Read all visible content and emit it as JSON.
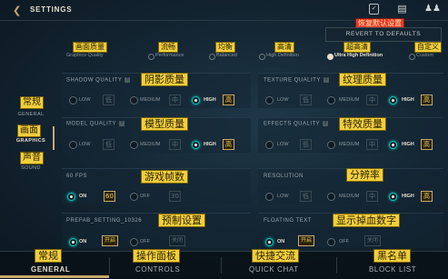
{
  "header": {
    "back_icon": "back-arrow-icon",
    "title": "SETTINGS",
    "icons": [
      "profile-card-icon",
      "chat-icon",
      "friends-icon"
    ]
  },
  "revert": {
    "label": "REVERT TO DEFAULTS",
    "annotation": "恢复默认设置"
  },
  "sidebar": {
    "items": [
      {
        "label": "GENERAL",
        "annotation": "常规"
      },
      {
        "label": "GRAPHICS",
        "annotation": "画面",
        "active": true
      },
      {
        "label": "SOUND",
        "annotation": "声音"
      }
    ]
  },
  "presets": {
    "title_annotation": "画面质量",
    "label": "Graphics Quality",
    "options": [
      {
        "label": "Performance",
        "annotation": "流畅"
      },
      {
        "label": "Balanced",
        "annotation": "均衡"
      },
      {
        "label": "High Definition",
        "annotation": "高清"
      },
      {
        "label": "Ultra High Definition",
        "annotation": "超高清",
        "selected": true
      },
      {
        "label": "Custom",
        "annotation": "自定义"
      }
    ]
  },
  "settings": {
    "shadow": {
      "title": "SHADOW QUALITY",
      "annotation": "阴影质量",
      "options": [
        {
          "label": "LOW",
          "box": "低"
        },
        {
          "label": "MEDIUM",
          "box": "中"
        },
        {
          "label": "HIGH",
          "box": "高",
          "selected": true
        }
      ]
    },
    "texture": {
      "title": "TEXTURE QUALITY",
      "annotation": "纹理质量",
      "options": [
        {
          "label": "LOW",
          "box": "低"
        },
        {
          "label": "MEDIUM",
          "box": "中"
        },
        {
          "label": "HIGH",
          "box": "高",
          "selected": true
        }
      ]
    },
    "model": {
      "title": "MODEL QUALITY",
      "annotation": "模型质量",
      "options": [
        {
          "label": "LOW",
          "box": "低"
        },
        {
          "label": "MEDIUM",
          "box": "中"
        },
        {
          "label": "HIGH",
          "box": "高",
          "selected": true
        }
      ]
    },
    "effects": {
      "title": "EFFECTS QUALITY",
      "annotation": "特效质量",
      "options": [
        {
          "label": "LOW",
          "box": "低"
        },
        {
          "label": "MEDIUM",
          "box": "中"
        },
        {
          "label": "HIGH",
          "box": "高",
          "selected": true
        }
      ]
    },
    "fps": {
      "title": "60 FPS",
      "annotation": "游戏帧数",
      "options": [
        {
          "label": "ON",
          "box": "60",
          "selected": true
        },
        {
          "label": "OFF",
          "box": "30"
        }
      ]
    },
    "resolution": {
      "title": "RESOLUTION",
      "annotation": "分辨率",
      "options": [
        {
          "label": "LOW",
          "box": "低"
        },
        {
          "label": "MEDIUM",
          "box": "中"
        },
        {
          "label": "HIGH",
          "box": "高",
          "selected": true
        }
      ]
    },
    "prefab": {
      "title": "PREFAB_SETTING_10326",
      "annotation": "预制设置",
      "options": [
        {
          "label": "ON",
          "box": "开启",
          "selected": true
        },
        {
          "label": "OFF",
          "box": "关闭"
        }
      ]
    },
    "floating": {
      "title": "FLOATING TEXT",
      "annotation": "显示掉血数字",
      "options": [
        {
          "label": "ON",
          "box": "开启",
          "selected": true
        },
        {
          "label": "OFF",
          "box": "关闭"
        }
      ]
    }
  },
  "bottom_nav": [
    {
      "label": "GENERAL",
      "annotation": "常规",
      "active": true
    },
    {
      "label": "CONTROLS",
      "annotation": "操作面板"
    },
    {
      "label": "QUICK CHAT",
      "annotation": "快捷交流"
    },
    {
      "label": "BLOCK LIST",
      "annotation": "黑名单"
    }
  ],
  "colors": {
    "accent_gold": "#c8aa6e",
    "selected_teal": "#0ac8b9",
    "annotation_yellow": "#f1cf3c",
    "annotation_red": "#e53a2c"
  }
}
